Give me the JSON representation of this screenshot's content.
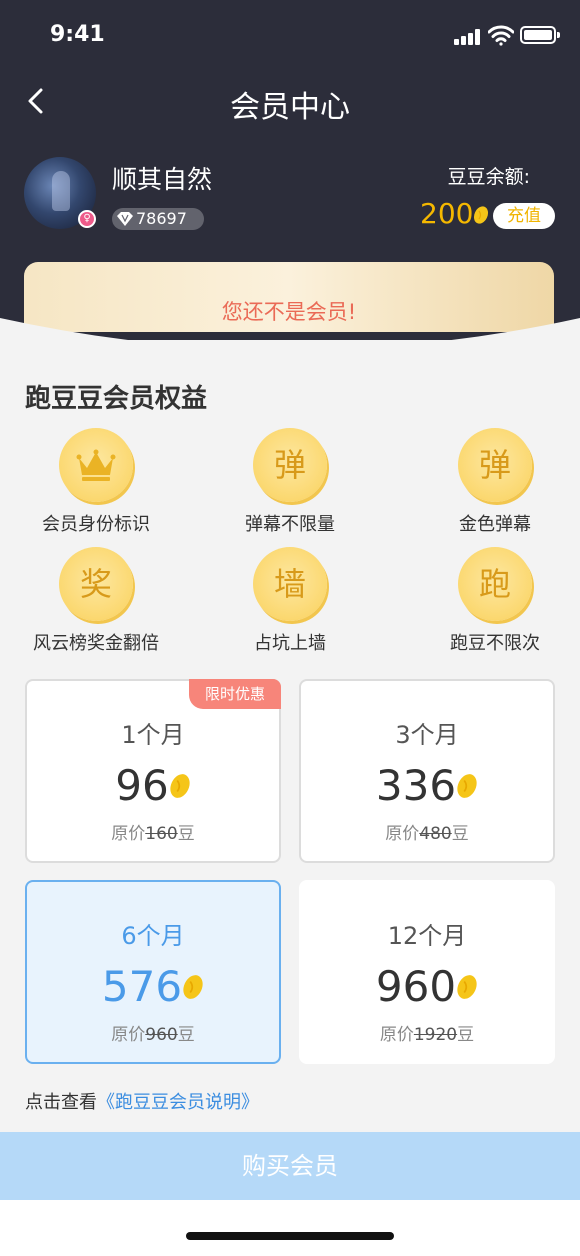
{
  "status_bar": {
    "time": "9:41"
  },
  "nav": {
    "title": "会员中心",
    "back_icon": "chevron-left-icon"
  },
  "user": {
    "name": "顺其自然",
    "vip_points": "78697"
  },
  "balance": {
    "label": "豆豆余额:",
    "amount": "200",
    "charge_label": "充值"
  },
  "banner": {
    "text": "您还不是会员!"
  },
  "benefits": {
    "title": "跑豆豆会员权益",
    "items": [
      {
        "glyph": "",
        "icon": "crown-icon",
        "label": "会员身份标识"
      },
      {
        "glyph": "弹",
        "label": "弹幕不限量"
      },
      {
        "glyph": "弹",
        "label": "金色弹幕"
      },
      {
        "glyph": "奖",
        "label": "风云榜奖金翻倍"
      },
      {
        "glyph": "墙",
        "label": "占坑上墙"
      },
      {
        "glyph": "跑",
        "label": "跑豆不限次"
      }
    ]
  },
  "plans": [
    {
      "months": "1个月",
      "price": "96",
      "orig_prefix": "原价",
      "orig": "160",
      "unit": "豆",
      "tag": "限时优惠"
    },
    {
      "months": "3个月",
      "price": "336",
      "orig_prefix": "原价",
      "orig": "480",
      "unit": "豆"
    },
    {
      "months": "6个月",
      "price": "576",
      "orig_prefix": "原价",
      "orig": "960",
      "unit": "豆",
      "selected": true
    },
    {
      "months": "12个月",
      "price": "960",
      "orig_prefix": "原价",
      "orig": "1920",
      "unit": "豆"
    }
  ],
  "note": {
    "prefix": "点击查看",
    "link": "《跑豆豆会员说明》"
  },
  "buy_button": "购买会员",
  "colors": {
    "header_bg": "#2c2d3a",
    "accent_gold": "#f5b800",
    "selected_blue": "#4a9ae8",
    "buy_button": "#b5d9f8",
    "banner_text": "#ea6a56"
  }
}
